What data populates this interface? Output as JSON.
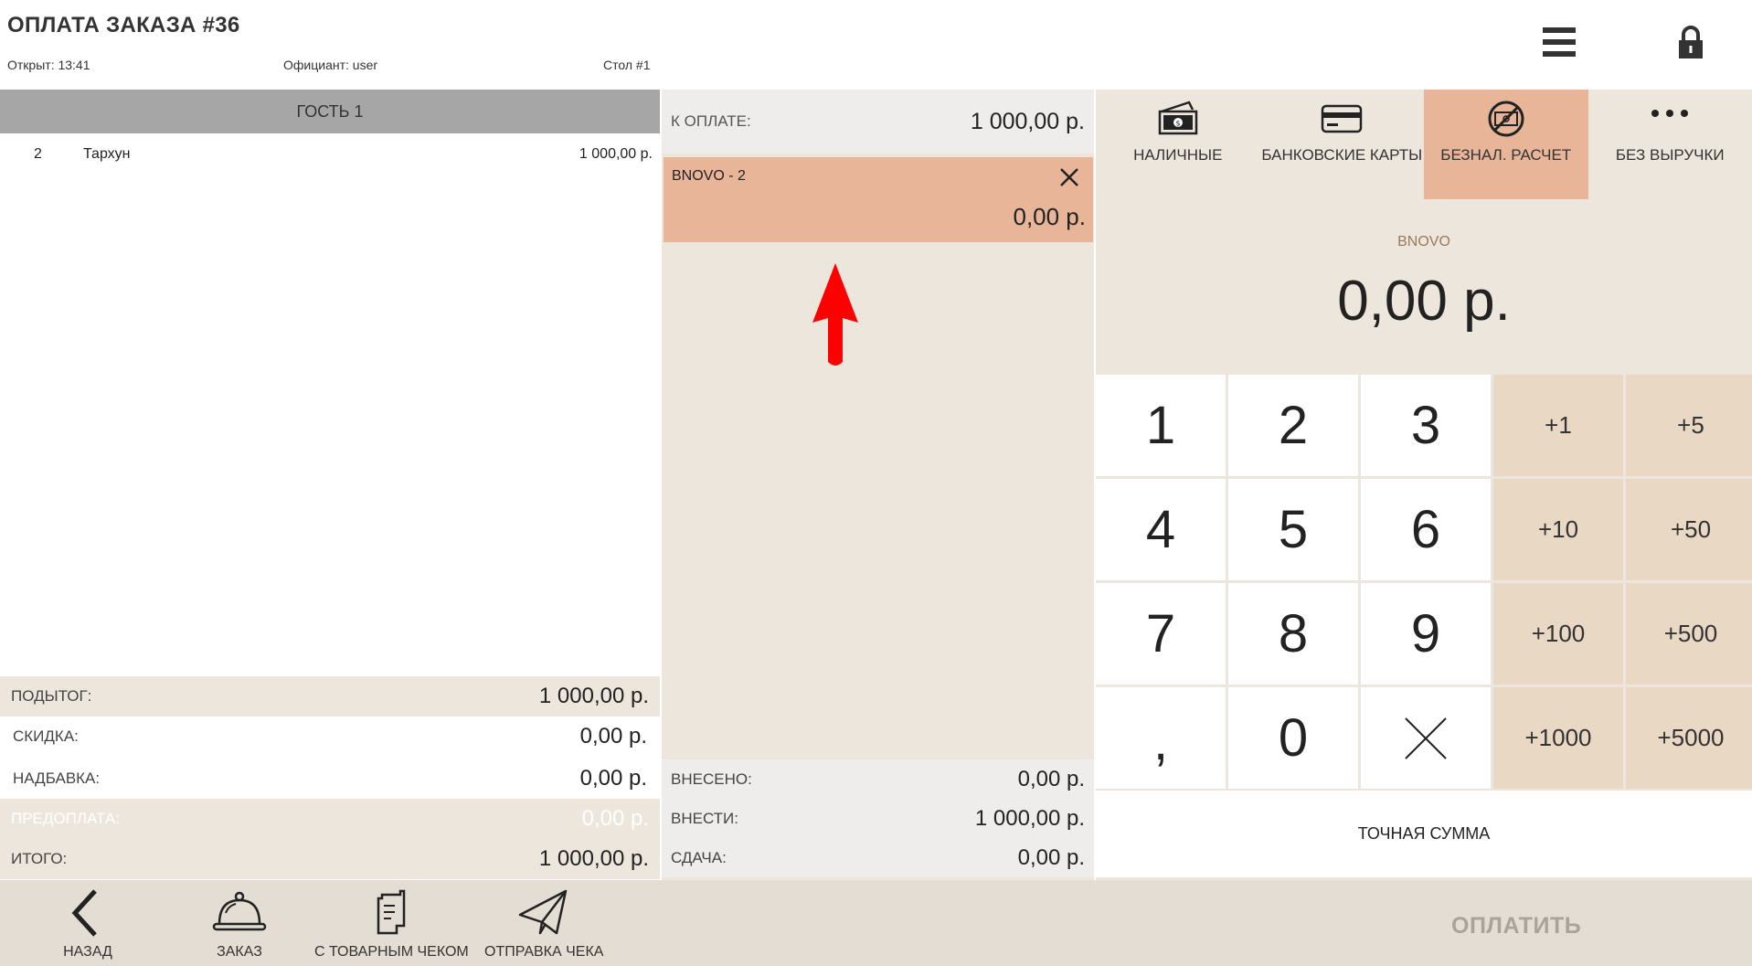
{
  "header": {
    "title": "ОПЛАТА ЗАКАЗА #36",
    "opened": "Открыт: 13:41",
    "waiter": "Официант: user",
    "table": "Стол #1",
    "menu_icon": "hamburger-menu-icon",
    "lock_icon": "lock-icon"
  },
  "order": {
    "guest_label": "ГОСТЬ 1",
    "items": [
      {
        "qty": "2",
        "name": "Тархун",
        "price": "1 000,00 р."
      }
    ],
    "totals": [
      {
        "label": "ПОДЫТОГ:",
        "value": "1 000,00 р."
      },
      {
        "label": "СКИДКА:",
        "value": "0,00 р."
      },
      {
        "label": "НАДБАВКА:",
        "value": "0,00 р."
      },
      {
        "label": "ПРЕДОПЛАТА:",
        "value": "0,00 р."
      },
      {
        "label": "ИТОГО:",
        "value": "1 000,00 р."
      }
    ]
  },
  "payment": {
    "due_label": "К ОПЛАТЕ:",
    "due_value": "1 000,00 р.",
    "card": {
      "name": "BNOVO - 2",
      "amount": "0,00 р."
    },
    "summary": [
      {
        "label": "ВНЕСЕНО:",
        "value": "0,00 р."
      },
      {
        "label": "ВНЕСТИ:",
        "value": "1 000,00 р."
      },
      {
        "label": "СДАЧА:",
        "value": "0,00 р."
      }
    ]
  },
  "methods": [
    {
      "label": "НАЛИЧНЫЕ",
      "icon": "cash-icon"
    },
    {
      "label": "БАНКОВСКИЕ КАРТЫ",
      "icon": "bank-card-icon"
    },
    {
      "label": "БЕЗНАЛ. РАСЧЕТ",
      "icon": "no-cash-icon"
    },
    {
      "label": "БЕЗ ВЫРУЧКИ",
      "icon": "more-dots-icon"
    }
  ],
  "selected": {
    "label": "BNOVO",
    "amount": "0,00 р."
  },
  "keypad": {
    "digits": [
      "1",
      "2",
      "3",
      "4",
      "5",
      "6",
      "7",
      "8",
      "9",
      ",",
      "0"
    ],
    "plus": [
      "+1",
      "+5",
      "+10",
      "+50",
      "+100",
      "+500",
      "+1000",
      "+5000"
    ],
    "exact_label": "ТОЧНАЯ СУММА"
  },
  "bottom": {
    "back": "НАЗАД",
    "order": "ЗАКАЗ",
    "receipt": "С ТОВАРНЫМ ЧЕКОМ",
    "send": "ОТПРАВКА ЧЕКА",
    "pay": "ОПЛАТИТЬ"
  },
  "colors": {
    "accent": "#e8b598",
    "panel": "#ede6dc",
    "guest_header": "#a6a6a6",
    "plus_key": "#e8d8c4",
    "arrow": "#ff0000",
    "pay_disabled": "#a9a39a"
  }
}
